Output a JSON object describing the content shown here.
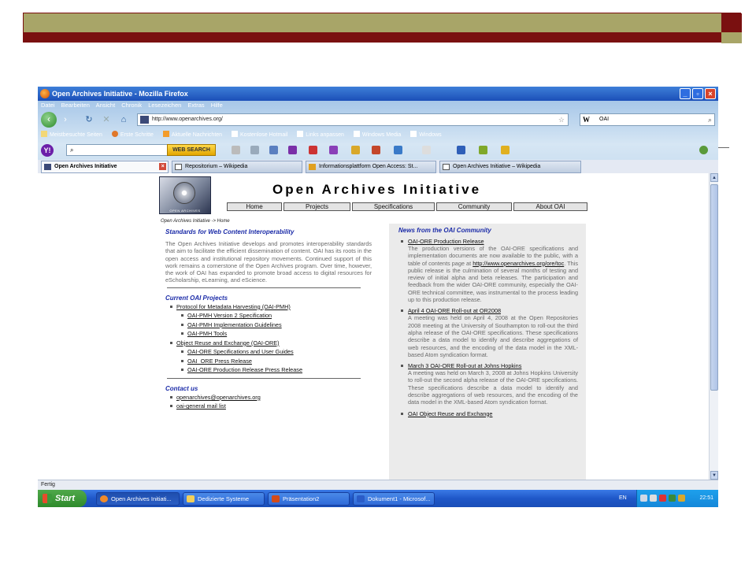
{
  "browser": {
    "window_title": "Open Archives Initiative - Mozilla Firefox",
    "menu": [
      "Datei",
      "Bearbeiten",
      "Ansicht",
      "Chronik",
      "Lesezeichen",
      "Extras",
      "Hilfe"
    ],
    "url": "http://www.openarchives.org/",
    "search_engine_label": "W",
    "search_value": "OAI",
    "bookmarks": [
      "Meistbesuchte Seiten",
      "Erste Schritte",
      "Aktuelle Nachrichten",
      "Kostenlose Hotmail",
      "Links anpassen",
      "Windows Media",
      "Windows"
    ],
    "yahoo_label": "Y!",
    "web_search_label": "WEB SEARCH",
    "tabs": [
      {
        "label": "Open Archives Initiative",
        "active": true
      },
      {
        "label": "Repositorium – Wikipedia",
        "active": false
      },
      {
        "label": "Informationsplattform Open Access: St...",
        "active": false
      },
      {
        "label": "Open Archives Initiative – Wikipedia",
        "active": false
      }
    ],
    "status": "Fertig"
  },
  "page": {
    "logo_caption": "OPEN ARCHIVES",
    "title": "Open Archives Initiative",
    "nav": [
      "Home",
      "Projects",
      "Specifications",
      "Community",
      "About OAI"
    ],
    "breadcrumb": "Open Archives Initiative -> Home",
    "left": {
      "standards_heading": "Standards for Web Content Interoperability",
      "intro": "The Open Archives Initiative develops and promotes interoperability standards that aim to facilitate the efficient dissemination of content. OAI has its roots in the open access and institutional repository movements. Continued support of this work remains a cornerstone of the Open Archives program. Over time, however, the work of OAI has expanded to promote broad access to digital resources for eScholarship, eLearning, and eScience.",
      "projects_heading": "Current OAI Projects",
      "pmh": "Protocol for Metadata Harvesting (OAI-PMH)",
      "pmh_links": [
        "OAI-PMH Version 2 Specification",
        "OAI-PMH Implementation Guidelines",
        "OAI-PMH Tools"
      ],
      "ore": "Object Reuse and Exchange (OAI-ORE)",
      "ore_links": [
        "OAI-ORE Specifications and User Guides",
        "OAI_ORE Press Release",
        "OAI-ORE Production Release Press Release"
      ],
      "contact_heading": "Contact us",
      "contact_links": [
        "openarchives@openarchives.org",
        "oai-general mail list"
      ]
    },
    "news": {
      "heading": "News from the OAI Community",
      "items": [
        {
          "title": "OAI-ORE Production Release",
          "body_pre": "The production versions of the OAI-ORE specifications and implementation documents are now available to the public, with a table of contents page at ",
          "url": "http://www.openarchives.org/ore/toc",
          "body_post": ". This public release is the culmination of several months of testing and review of initial alpha and beta releases. The participation and feedback from the wider OAI-ORE community, especially the OAI-ORE technical committee, was instrumental to the process leading up to this production release."
        },
        {
          "title": "April 4 OAI-ORE Roll-out at OR2008",
          "body": "A meeting was held on April 4, 2008 at the Open Repositories 2008 meeting at the University of Southampton to roll-out the third alpha release of the OAI-ORE specifications. These specifications describe a data model to identify and describe aggregations of web resources, and the encoding of the data model in the XML-based Atom syndication format."
        },
        {
          "title": "March 3 OAI-ORE Roll-out at Johns Hopkins",
          "body": "A meeting was held on March 3, 2008 at Johns Hopkins University to roll-out the second alpha release of the OAI-ORE specifications. These specifications describe a data model to identify and describe aggregations of web resources, and the encoding of the data model in the XML-based Atom syndication format."
        },
        {
          "title": "OAI Object Reuse and Exchange",
          "body": ""
        }
      ]
    }
  },
  "taskbar": {
    "start": "Start",
    "tasks": [
      "Open Archives Initiati...",
      "Dedizierte Systeme",
      "Präsentation2",
      "Dokument1 - Microsof..."
    ],
    "lang": "EN",
    "time": "22:51"
  }
}
